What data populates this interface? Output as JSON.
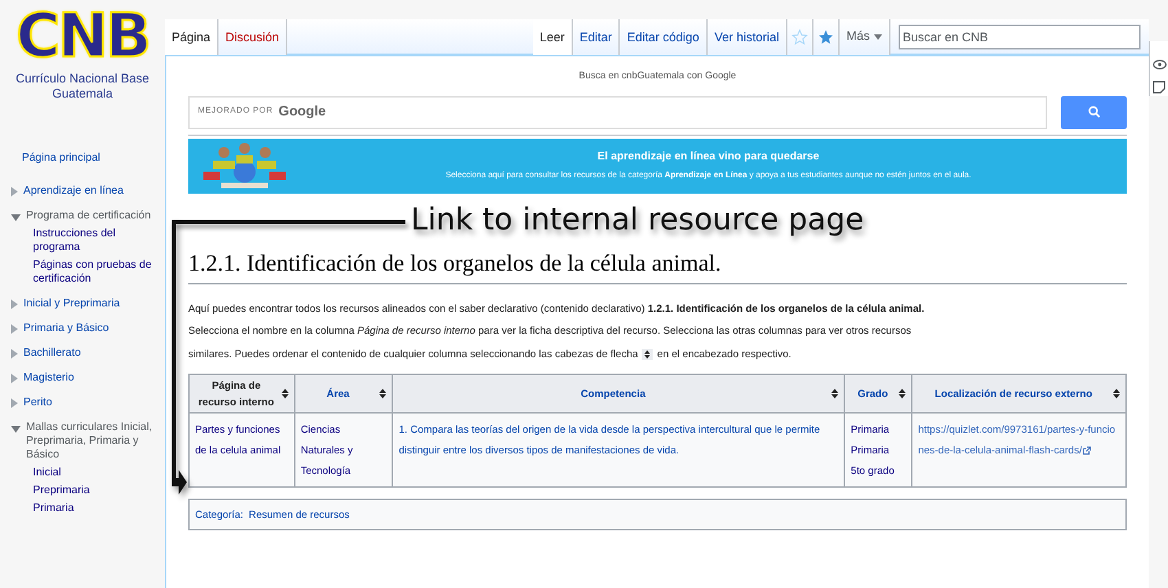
{
  "logo": {
    "letters": "CNB",
    "subtitle": [
      "Currículo Nacional Base",
      "Guatemala"
    ]
  },
  "sidebar": {
    "items": [
      {
        "label": "Página principal",
        "kind": "link"
      },
      {
        "label": "Aprendizaje en línea",
        "kind": "section",
        "expanded": false
      },
      {
        "label": "Programa de certificación",
        "kind": "section",
        "expanded": true,
        "children": [
          {
            "label": "Instrucciones del programa"
          },
          {
            "label": "Páginas con pruebas de certificación"
          }
        ]
      },
      {
        "label": "Inicial y Preprimaria",
        "kind": "section",
        "expanded": false
      },
      {
        "label": "Primaria y Básico",
        "kind": "section",
        "expanded": false
      },
      {
        "label": "Bachillerato",
        "kind": "section",
        "expanded": false
      },
      {
        "label": "Magisterio",
        "kind": "section",
        "expanded": false
      },
      {
        "label": "Perito",
        "kind": "section",
        "expanded": false
      },
      {
        "label": "Mallas curriculares Inicial, Preprimaria, Primaria y Básico",
        "kind": "section",
        "expanded": true,
        "children": [
          {
            "label": "Inicial"
          },
          {
            "label": "Preprimaria"
          },
          {
            "label": "Primaria"
          }
        ]
      }
    ]
  },
  "namespace_tabs": [
    {
      "label": "Página",
      "selected": true
    },
    {
      "label": "Discusión",
      "selected": false
    }
  ],
  "view_tabs": [
    {
      "label": "Leer",
      "selected": true
    },
    {
      "label": "Editar",
      "selected": false
    },
    {
      "label": "Editar código",
      "selected": false
    },
    {
      "label": "Ver historial",
      "selected": false
    }
  ],
  "more_menu": "Más",
  "search": {
    "placeholder": "Buscar en CNB"
  },
  "google_search": {
    "caption": "Busca en cnbGuatemala con Google",
    "branding": "MEJORADO POR",
    "brand": "Google"
  },
  "banner": {
    "title": "El aprendizaje en línea vino para quedarse",
    "text": "Selecciona aquí para consultar los recursos de la categoría **Aprendizaje en Línea** y apoya a tus estudiantes aunque no estén juntos en el aula."
  },
  "annotation": "Link to internal resource page",
  "heading": "1.2.1. Identificación de los organelos de la célula animal.",
  "paragraphs": [
    "Aquí puedes encontrar todos los recursos alineados con el saber declarativo (contenido declarativo) **1.2.1. Identificación de los organelos de la célula animal.**"
  ],
  "instructions": {
    "line_1": "Selecciona el nombre en la columna *Página de recurso interno* para ver la ficha descriptiva del recurso. Selecciona las otras columnas para ver otros recursos",
    "before": "similares. Puedes ordenar el contenido de cualquier columna seleccionando las cabezas de flecha",
    "after": "en el encabezado respectivo."
  },
  "table": {
    "columns": [
      {
        "label": "Página de recurso interno",
        "kind": "plain"
      },
      {
        "label": "Área",
        "kind": "link"
      },
      {
        "label": "Competencia",
        "kind": "link"
      },
      {
        "label": "Grado",
        "kind": "link"
      },
      {
        "label": "Localización de recurso externo",
        "kind": "link"
      }
    ],
    "rows": [
      {
        "cells": [
          {
            "kind": "visited",
            "lines": [
              "Partes y funciones de la celula animal"
            ]
          },
          {
            "kind": "visited",
            "lines": [
              "Ciencias Naturales y Tecnología"
            ]
          },
          {
            "kind": "link",
            "lines": [
              "1. Compara las teorías del origen de la vida desde la perspectiva intercultural que le permite distinguir entre los diversos tipos de manifestaciones de vida."
            ]
          },
          {
            "kind": "visited",
            "lines": [
              "Primaria",
              "Primaria 5to grado"
            ]
          },
          {
            "kind": "external",
            "lines": [
              "https://quizlet.com/9973161/partes-y-funciones-de-la-celula-animal-flash-cards/"
            ]
          }
        ]
      }
    ]
  },
  "categories": {
    "label": "Categoría:",
    "items": [
      "Resumen de recursos"
    ]
  }
}
